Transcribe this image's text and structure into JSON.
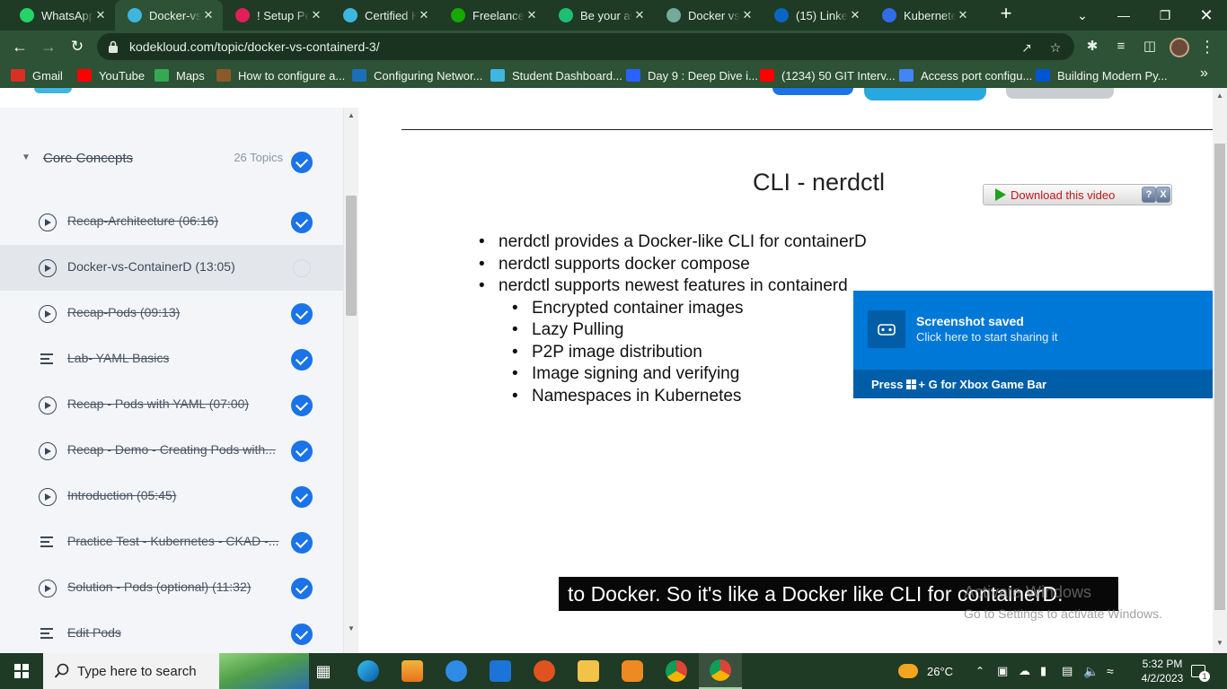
{
  "browser": {
    "tabs": [
      {
        "title": "WhatsApp",
        "active": false,
        "icon": "whatsapp-icon",
        "color": "#25d366"
      },
      {
        "title": "Docker-vs-",
        "active": true,
        "icon": "kodekloud-icon",
        "color": "#3fb6e0"
      },
      {
        "title": "! Setup Pe",
        "active": false,
        "icon": "slack-icon",
        "color": "#e01e5a"
      },
      {
        "title": "Certified K",
        "active": false,
        "icon": "kodekloud-icon",
        "color": "#3fb6e0"
      },
      {
        "title": "Freelance",
        "active": false,
        "icon": "upwork-icon",
        "color": "#14a800"
      },
      {
        "title": "Be your aw",
        "active": false,
        "icon": "fiverr-icon",
        "color": "#1dbf73"
      },
      {
        "title": "Docker vs",
        "active": false,
        "icon": "chatgpt-icon",
        "color": "#74aa9c"
      },
      {
        "title": "(15) Linked",
        "active": false,
        "icon": "linkedin-icon",
        "color": "#0a66c2"
      },
      {
        "title": "Kubernete",
        "active": false,
        "icon": "kubernetes-icon",
        "color": "#326ce5"
      }
    ],
    "url": "kodekloud.com/topic/docker-vs-containerd-3/",
    "bookmarks": [
      {
        "label": "Gmail",
        "icon": "gmail-icon",
        "color": "#d93025"
      },
      {
        "label": "YouTube",
        "icon": "youtube-icon",
        "color": "#ff0000"
      },
      {
        "label": "Maps",
        "icon": "maps-icon",
        "color": "#34a853"
      },
      {
        "label": "How to configure a...",
        "icon": "bookmark-page-icon",
        "color": "#8a5a2b"
      },
      {
        "label": "Configuring Networ...",
        "icon": "vmware-icon",
        "color": "#1d6fb8"
      },
      {
        "label": "Student Dashboard...",
        "icon": "kodekloud-icon",
        "color": "#3fb6e0"
      },
      {
        "label": "Day 9 : Deep Dive i...",
        "icon": "hashnode-icon",
        "color": "#2962ff"
      },
      {
        "label": "(1234) 50 GIT Interv...",
        "icon": "youtube-icon",
        "color": "#ff0000"
      },
      {
        "label": "Access port configu...",
        "icon": "bookmark-page-icon",
        "color": "#4285f4"
      },
      {
        "label": "Building Modern Py...",
        "icon": "coursera-icon",
        "color": "#0056d2"
      }
    ],
    "more_bookmarks": "»"
  },
  "sidebar": {
    "section_title": "Core Concepts",
    "section_count": "26 Topics",
    "lessons": [
      {
        "label": "Recap-Architecture (06:16)",
        "type": "video",
        "done": true
      },
      {
        "label": "Docker-vs-ContainerD (13:05)",
        "type": "video",
        "done": false,
        "current": true
      },
      {
        "label": "Recap-Pods (09:13)",
        "type": "video",
        "done": true
      },
      {
        "label": "Lab- YAML Basics",
        "type": "text",
        "done": true
      },
      {
        "label": "Recap - Pods with YAML (07:00)",
        "type": "video",
        "done": true
      },
      {
        "label": "Recap - Demo - Creating Pods with...",
        "type": "video",
        "done": true
      },
      {
        "label": "Introduction (05:45)",
        "type": "video",
        "done": true
      },
      {
        "label": "Practice Test - Kubernetes - CKAD -...",
        "type": "text",
        "done": true
      },
      {
        "label": "Solution - Pods (optional) (11:32)",
        "type": "video",
        "done": true
      },
      {
        "label": "Edit Pods",
        "type": "text",
        "done": true
      }
    ]
  },
  "slide": {
    "title": "CLI - nerdctl",
    "bullets": [
      {
        "text": "nerdctl provides a Docker-like CLI for containerD",
        "level": 1
      },
      {
        "text": "nerdctl supports docker compose",
        "level": 1
      },
      {
        "text": "nerdctl supports newest features in containerd",
        "level": 1
      },
      {
        "text": "Encrypted container images",
        "level": 2
      },
      {
        "text": "Lazy Pulling",
        "level": 2
      },
      {
        "text": "P2P image distribution",
        "level": 2
      },
      {
        "text": "Image signing and verifying",
        "level": 2
      },
      {
        "text": "Namespaces in Kubernetes",
        "level": 2
      }
    ],
    "caption": "to Docker. So it's like a Docker like CLI for containerD."
  },
  "download": {
    "label": "Download this video",
    "help": "?",
    "close": "X"
  },
  "watermark": {
    "title": "Activate Windows",
    "subtitle": "Go to Settings to activate Windows."
  },
  "toast": {
    "title": "Screenshot saved",
    "subtitle": "Click here to start sharing it",
    "footer_prefix": "Press",
    "footer_suffix": "+ G for Xbox Game Bar"
  },
  "taskbar": {
    "search_placeholder": "Type here to search",
    "weather": "26°C",
    "time": "5:32 PM",
    "date": "4/2/2023",
    "notifications": "1"
  }
}
